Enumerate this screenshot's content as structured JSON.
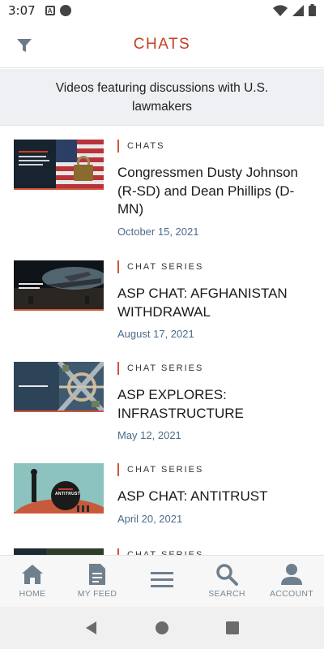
{
  "status_bar": {
    "time": "3:07",
    "notif_icon_label": "A"
  },
  "app_bar": {
    "title": "CHATS"
  },
  "banner": {
    "text": "Videos featuring discussions with U.S. lawmakers"
  },
  "items": [
    {
      "category": "CHATS",
      "title": "Congressmen Dusty Johnson (R-SD) and Dean Phillips (D-MN)",
      "date": "October 15, 2021",
      "thumb_caption": "",
      "thumb_icon": "padlock-flag-image"
    },
    {
      "category": "CHAT SERIES",
      "title": "ASP CHAT: AFGHANISTAN WITHDRAWAL",
      "date": "August 17, 2021",
      "thumb_caption": "",
      "thumb_icon": "military-plane-image"
    },
    {
      "category": "CHAT SERIES",
      "title": "ASP EXPLORES: INFRASTRUCTURE",
      "date": "May 12, 2021",
      "thumb_caption": "",
      "thumb_icon": "highway-interchange-image"
    },
    {
      "category": "CHAT SERIES",
      "title": "ASP CHAT: ANTITRUST",
      "date": "April 20, 2021",
      "thumb_caption": "ANTITRUST",
      "thumb_icon": "antitrust-illustration-image"
    },
    {
      "category": "CHAT SERIES",
      "title": "",
      "date": "",
      "thumb_caption": "",
      "thumb_icon": "partial-thumbnail-image"
    }
  ],
  "bottom_nav": [
    {
      "label": "HOME",
      "icon": "home-icon"
    },
    {
      "label": "MY FEED",
      "icon": "feed-icon"
    },
    {
      "label": "",
      "icon": "menu-icon"
    },
    {
      "label": "SEARCH",
      "icon": "search-icon"
    },
    {
      "label": "ACCOUNT",
      "icon": "account-icon"
    }
  ],
  "colors": {
    "accent": "#c4411f",
    "date": "#4b6b8a",
    "nav_icon": "#7a8791"
  }
}
